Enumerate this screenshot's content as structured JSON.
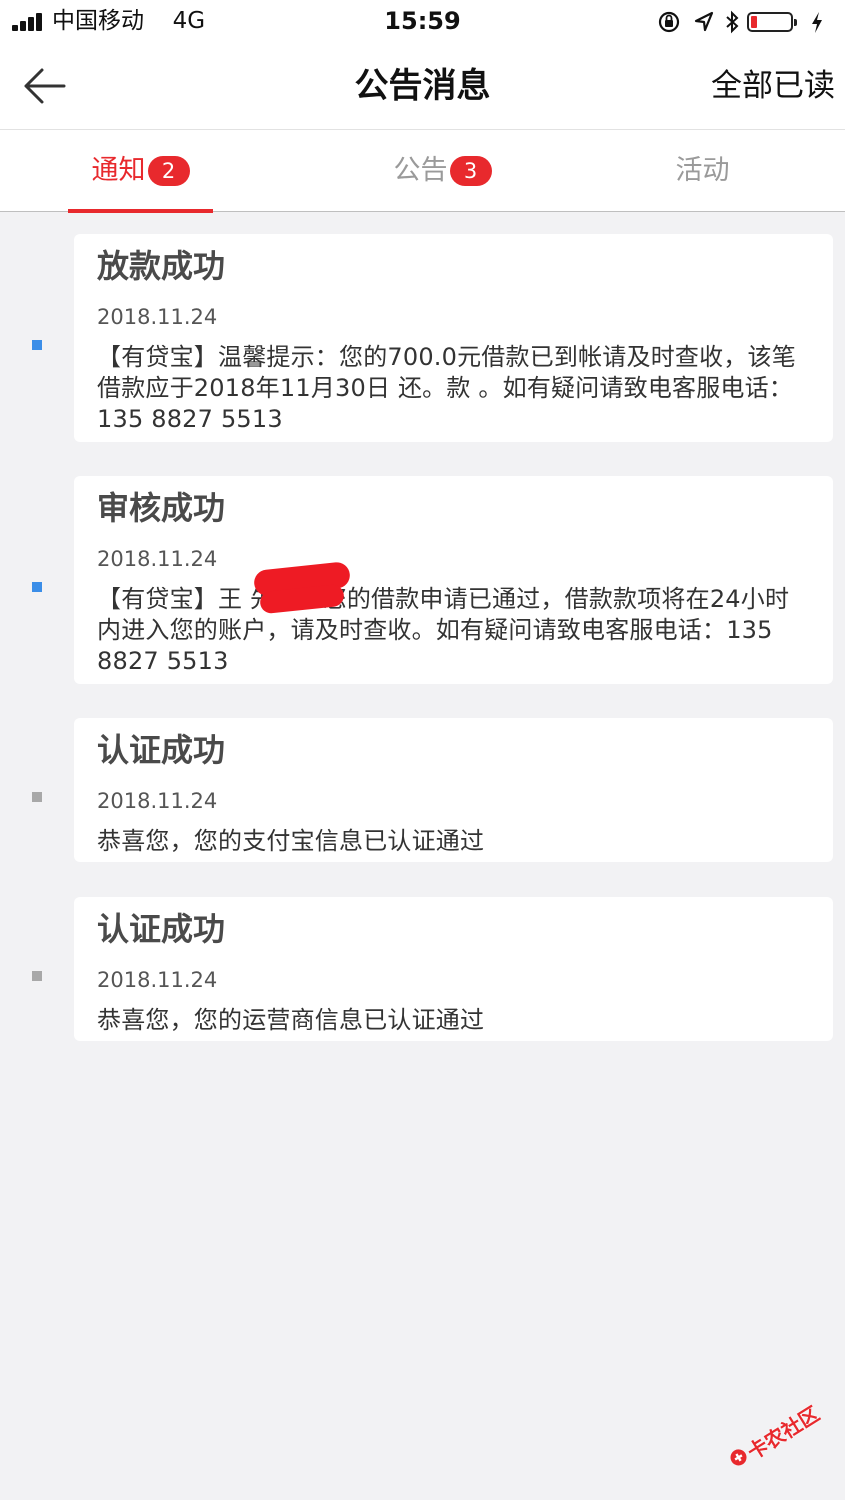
{
  "status_bar": {
    "carrier": "中国移动",
    "network": "4G",
    "time": "15:59",
    "icons": [
      "orientation-lock-icon",
      "location-arrow-icon",
      "bluetooth-icon",
      "battery-low-icon",
      "charging-bolt-icon"
    ],
    "battery_level_fraction": 0.1,
    "battery_color": "#e8292d"
  },
  "nav": {
    "back_icon": "arrow-left-icon",
    "title": "公告消息",
    "read_all_label": "全部已读"
  },
  "tabs": [
    {
      "label": "通知",
      "badge": "2",
      "active": true
    },
    {
      "label": "公告",
      "badge": "3",
      "active": false
    },
    {
      "label": "活动",
      "badge": null,
      "active": false
    }
  ],
  "accent_color": "#e8292d",
  "unread_dot_color": "#3b8ee8",
  "read_dot_color": "#a8a8a8",
  "messages": [
    {
      "title": "放款成功",
      "date": "2018.11.24",
      "body": "【有贷宝】温馨提示：您的700.0元借款已到帐请及时查收，该笔借款应于2018年11月30日 还。款 。如有疑问请致电客服电话：135 8827 5513",
      "unread": true
    },
    {
      "title": "审核成功",
      "date": "2018.11.24",
      "body": "【有贷宝】王 先生，您的借款申请已通过，借款款项将在24小时内进入您的账户，请及时查收。如有疑问请致电客服电话：135 8827 5513",
      "unread": true
    },
    {
      "title": "认证成功",
      "date": "2018.11.24",
      "body": "恭喜您，您的支付宝信息已认证通过",
      "unread": false
    },
    {
      "title": "认证成功",
      "date": "2018.11.24",
      "body": "恭喜您，您的运营商信息已认证通过",
      "unread": false
    }
  ],
  "watermark": {
    "text": "卡农社区"
  }
}
